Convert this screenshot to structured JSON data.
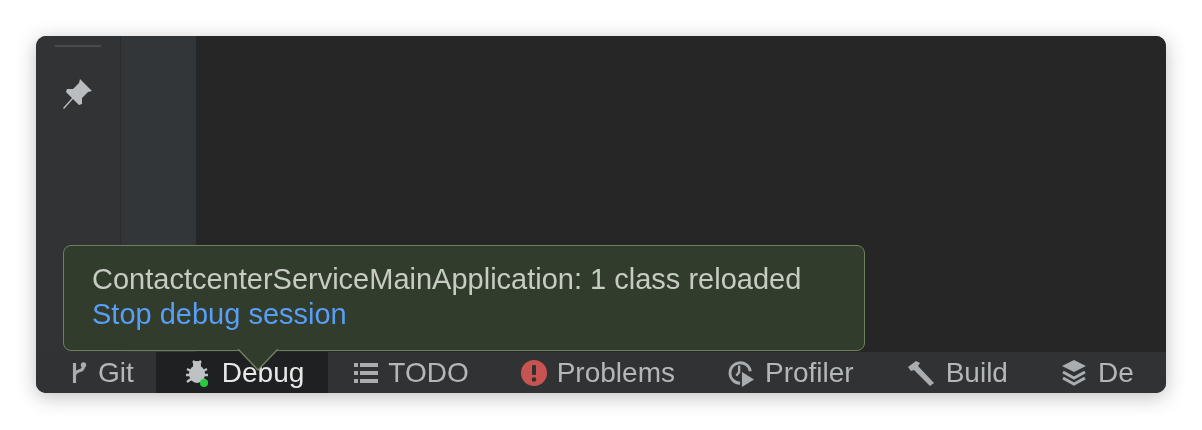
{
  "notification": {
    "message": "ContactcenterServiceMainApplication: 1 class reloaded",
    "link": "Stop debug session"
  },
  "tool_tabs": [
    {
      "label": "Git",
      "kind": "branch",
      "selected": false
    },
    {
      "label": "Debug",
      "kind": "bug",
      "selected": true
    },
    {
      "label": "TODO",
      "kind": "list",
      "selected": false
    },
    {
      "label": "Problems",
      "kind": "error",
      "selected": false
    },
    {
      "label": "Profiler",
      "kind": "profiler",
      "selected": false
    },
    {
      "label": "Build",
      "kind": "hammer",
      "selected": false
    },
    {
      "label": "De",
      "kind": "layers",
      "selected": false
    }
  ]
}
